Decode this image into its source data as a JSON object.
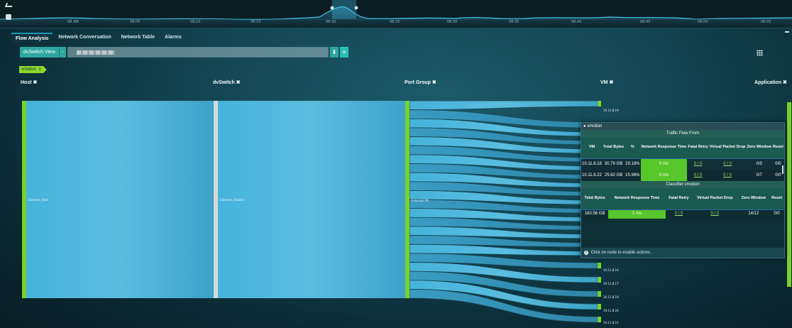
{
  "timeline": {
    "labels": [
      "08 AM",
      "08:05",
      "08:10",
      "08:15",
      "08:20",
      "08:25",
      "08:30",
      "08:35",
      "08:40",
      "08:45",
      "08:50",
      "08:55"
    ]
  },
  "tabs": [
    "Flow Analysis",
    "Network Conversation",
    "Network Table",
    "Alarms"
  ],
  "active_tab": "Flow Analysis",
  "filter": {
    "view_label": "dvSwitch View",
    "dropdown_symbol": "-",
    "download_symbol": "⬇",
    "menu_symbol": "≡"
  },
  "tag": {
    "label": "vmotion",
    "close": "x"
  },
  "columns": {
    "host": "Host ✖",
    "dvswitch": "dvSwitch ✖",
    "portgroup": "Port Group ✖",
    "vm": "VM ✖",
    "application": "Application ✖"
  },
  "nodes": {
    "host": "External_Host",
    "dvswitch": "External_vSwitch",
    "portgroup": "External_PG",
    "vm_top": "10.11.8.19",
    "vm_bottom": [
      "10.11.8.16",
      "10.11.8.17",
      "10.11.8.19",
      "10.11.8.24",
      "10.11.8.15"
    ]
  },
  "popover": {
    "title": "vmotion",
    "section1": "Traffic Flow From",
    "section2": "Classifier:vmotion",
    "headers1": [
      "VM",
      "Total Bytes",
      "%",
      "Network Response Time",
      "Fatal Retry",
      "Virtual Packet Drop",
      "Zero Window",
      "Reset"
    ],
    "rows": [
      {
        "vm": "10.11.8.18",
        "bytes": "30.79 GB",
        "pct": "19.18%",
        "rt": "0 ms",
        "fatal": "0 / 0",
        "drop": "0 / 0",
        "zero": "0/3",
        "reset": "0/0"
      },
      {
        "vm": "10.11.8.22",
        "bytes": "25.62 GB",
        "pct": "15.96%",
        "rt": "0 ms",
        "fatal": "0 / 0",
        "drop": "0 / 0",
        "zero": "0/7",
        "reset": "0/0"
      }
    ],
    "headers2": [
      "Total Bytes",
      "Network Response Time",
      "Fatal Retry",
      "Virtual Packet Drop",
      "Zero Window",
      "Reset"
    ],
    "classifier_row": {
      "bytes": "160.56 GB",
      "rt": "1 ms",
      "fatal": "0 / 0",
      "drop": "0 / 0",
      "zero": "14/12",
      "reset": "0/0"
    },
    "footer": "Click on node to enable actions.",
    "info_symbol": "i"
  },
  "colors": {
    "accent_green": "#8dd82b",
    "flow_blue": "#3aa7cf",
    "node_green": "#78d22a",
    "rt_green": "#57c62a"
  }
}
